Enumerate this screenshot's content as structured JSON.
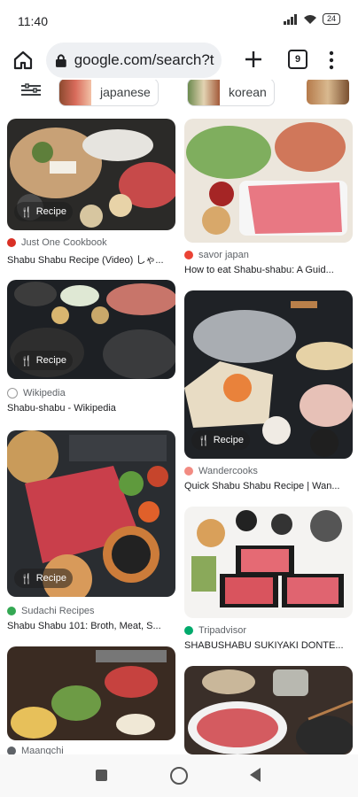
{
  "status": {
    "time": "11:40",
    "battery": "24"
  },
  "browser": {
    "url": "google.com/search?t",
    "tab_count": "9"
  },
  "chips": [
    {
      "label": "japanese"
    },
    {
      "label": "korean"
    }
  ],
  "results": [
    {
      "source": "Just One Cookbook",
      "source_color": "#d93025",
      "title": "Shabu Shabu Recipe (Video) しゃ...",
      "badge": "Recipe"
    },
    {
      "source": "savor japan",
      "source_color": "#ea4335",
      "title": "How to eat Shabu-shabu: A Guid...",
      "badge": ""
    },
    {
      "source": "Wikipedia",
      "source_color": "#5f6368",
      "title": "Shabu-shabu - Wikipedia",
      "badge": "Recipe"
    },
    {
      "source": "Wandercooks",
      "source_color": "#f28b82",
      "title": "Quick Shabu Shabu Recipe | Wan...",
      "badge": "Recipe"
    },
    {
      "source": "Sudachi Recipes",
      "source_color": "#34a853",
      "title": "Shabu Shabu 101: Broth, Meat, S...",
      "badge": "Recipe"
    },
    {
      "source": "Tripadvisor",
      "source_color": "#00aa6c",
      "title": "SHABUSHABU SUKIYAKI DONTE...",
      "badge": ""
    },
    {
      "source": "Maangchi",
      "source_color": "#5f6368",
      "title": "",
      "badge": ""
    },
    {
      "source": "",
      "source_color": "#5f6368",
      "title": "",
      "badge": ""
    }
  ],
  "icons": {
    "home": "home-icon",
    "lock": "lock-icon",
    "plus": "plus-icon",
    "menu": "more-vert-icon",
    "recipe": "utensils-icon"
  }
}
